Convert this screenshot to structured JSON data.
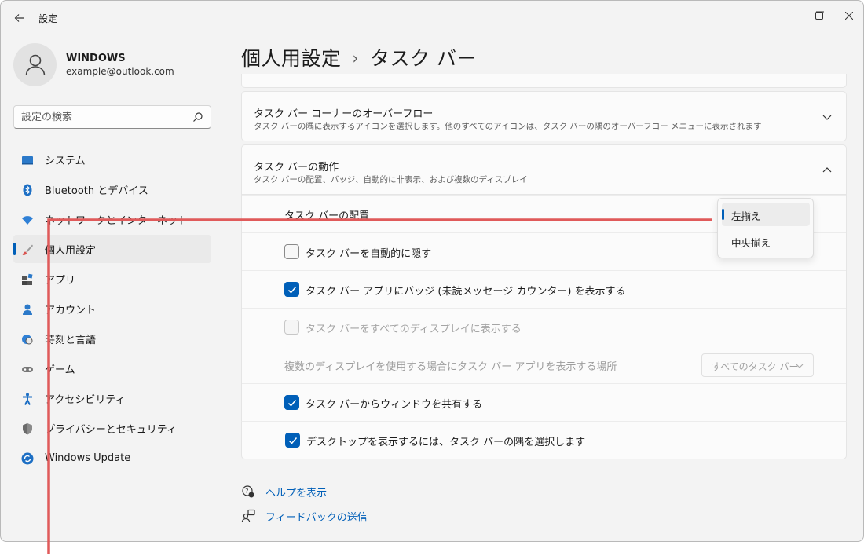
{
  "window": {
    "title": "設定"
  },
  "user": {
    "name": "WINDOWS",
    "email": "example@outlook.com"
  },
  "search": {
    "placeholder": "設定の検索"
  },
  "sidebar": {
    "items": [
      {
        "label": "システム",
        "icon": "system-icon"
      },
      {
        "label": "Bluetooth とデバイス",
        "icon": "bluetooth-icon"
      },
      {
        "label": "ネットワークとインターネット",
        "icon": "network-icon"
      },
      {
        "label": "個人用設定",
        "icon": "personalization-icon",
        "active": true
      },
      {
        "label": "アプリ",
        "icon": "apps-icon"
      },
      {
        "label": "アカウント",
        "icon": "account-icon"
      },
      {
        "label": "時刻と言語",
        "icon": "time-language-icon"
      },
      {
        "label": "ゲーム",
        "icon": "gaming-icon"
      },
      {
        "label": "アクセシビリティ",
        "icon": "accessibility-icon"
      },
      {
        "label": "プライバシーとセキュリティ",
        "icon": "privacy-icon"
      },
      {
        "label": "Windows Update",
        "icon": "windows-update-icon"
      }
    ]
  },
  "breadcrumb": {
    "parent": "個人用設定",
    "separator": "›",
    "current": "タスク バー"
  },
  "overflow_card": {
    "title": "タスク バー コーナーのオーバーフロー",
    "desc": "タスク バーの隅に表示するアイコンを選択します。他のすべてのアイコンは、タスク バーの隅のオーバーフロー メニューに表示されます"
  },
  "behavior_card": {
    "title": "タスク バーの動作",
    "desc": "タスク バーの配置、バッジ、自動的に非表示、および複数のディスプレイ"
  },
  "settings": {
    "alignment_label": "タスク バーの配置",
    "alignment_options": [
      "左揃え",
      "中央揃え"
    ],
    "alignment_selected": "左揃え",
    "autohide": {
      "label": "タスク バーを自動的に隠す",
      "checked": false
    },
    "badges": {
      "label": "タスク バー アプリにバッジ (未読メッセージ カウンター) を表示する",
      "checked": true
    },
    "all_displays": {
      "label": "タスク バーをすべてのディスプレイに表示する",
      "checked": false,
      "disabled": true
    },
    "multi_display": {
      "label": "複数のディスプレイを使用する場合にタスク バー アプリを表示する場所",
      "value": "すべてのタスク バー"
    },
    "share_window": {
      "label": "タスク バーからウィンドウを共有する",
      "checked": true
    },
    "show_desktop": {
      "label": "デスクトップを表示するには、タスク バーの隅を選択します",
      "checked": true
    }
  },
  "links": {
    "help": "ヘルプを表示",
    "feedback": "フィードバックの送信"
  },
  "colors": {
    "accent": "#005fb8",
    "annotation": "#e05a5a"
  }
}
